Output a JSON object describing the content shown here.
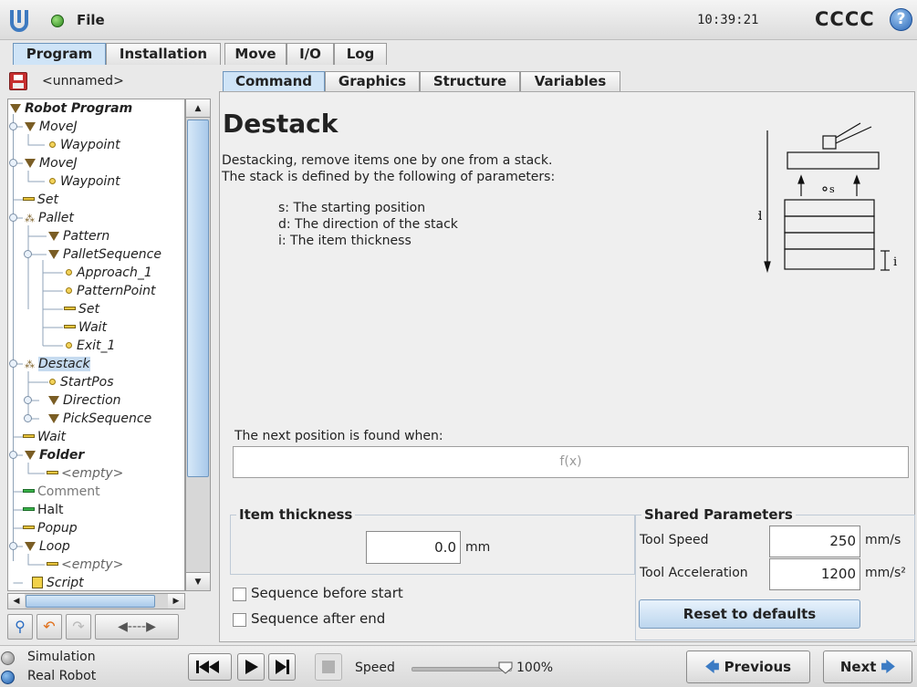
{
  "header": {
    "file_label": "File",
    "clock": "10:39:21",
    "robot_name": "CCCC",
    "help_label": "?"
  },
  "main_tabs": [
    {
      "label": "Program",
      "active": true
    },
    {
      "label": "Installation",
      "active": false
    },
    {
      "label": "Move",
      "active": false
    },
    {
      "label": "I/O",
      "active": false
    },
    {
      "label": "Log",
      "active": false
    }
  ],
  "program": {
    "name": "<unnamed>"
  },
  "tree": [
    {
      "label": "Robot Program",
      "icon": "triangle-icon",
      "style": "bold"
    },
    {
      "label": "MoveJ",
      "icon": "triangle-icon"
    },
    {
      "label": "Waypoint",
      "icon": "waypoint-icon"
    },
    {
      "label": "MoveJ",
      "icon": "triangle-icon"
    },
    {
      "label": "Waypoint",
      "icon": "waypoint-icon"
    },
    {
      "label": "Set",
      "icon": "set-icon"
    },
    {
      "label": "Pallet",
      "icon": "pallet-icon"
    },
    {
      "label": "Pattern",
      "icon": "triangle-icon"
    },
    {
      "label": "PalletSequence",
      "icon": "triangle-icon"
    },
    {
      "label": "Approach_1",
      "icon": "waypoint-icon"
    },
    {
      "label": "PatternPoint",
      "icon": "waypoint-icon"
    },
    {
      "label": "Set",
      "icon": "set-icon"
    },
    {
      "label": "Wait",
      "icon": "wait-icon"
    },
    {
      "label": "Exit_1",
      "icon": "waypoint-icon"
    },
    {
      "label": "Destack",
      "icon": "pallet-icon",
      "selected": true
    },
    {
      "label": "StartPos",
      "icon": "waypoint-icon"
    },
    {
      "label": "Direction",
      "icon": "triangle-icon"
    },
    {
      "label": "PickSequence",
      "icon": "triangle-icon"
    },
    {
      "label": "Wait",
      "icon": "wait-icon"
    },
    {
      "label": "Folder",
      "icon": "triangle-icon",
      "style": "bold"
    },
    {
      "label": "<empty>",
      "icon": "set-icon",
      "style": "grey-italic"
    },
    {
      "label": "Comment",
      "icon": "comment-icon",
      "style": "grey"
    },
    {
      "label": "Halt",
      "icon": "halt-icon",
      "style": "plain"
    },
    {
      "label": "Popup",
      "icon": "set-icon"
    },
    {
      "label": "Loop",
      "icon": "triangle-icon"
    },
    {
      "label": "<empty>",
      "icon": "set-icon",
      "style": "grey-italic"
    },
    {
      "label": "Script",
      "icon": "script-icon"
    }
  ],
  "sub_tabs": [
    {
      "label": "Command",
      "active": true
    },
    {
      "label": "Graphics",
      "active": false
    },
    {
      "label": "Structure",
      "active": false
    },
    {
      "label": "Variables",
      "active": false
    }
  ],
  "command": {
    "title": "Destack",
    "desc_line1": "Destacking, remove items one by one from a stack.",
    "desc_line2": "The stack is defined by the following of parameters:",
    "param_s": "s: The starting position",
    "param_d": "d: The direction of the stack",
    "param_i": "i: The item thickness",
    "next_label": "The next position is found when:",
    "expression_placeholder": "f(x)",
    "diagram_labels": {
      "d": "d",
      "s": "s",
      "i": "i"
    }
  },
  "item_thickness": {
    "title": "Item thickness",
    "value": "0.0",
    "unit": "mm"
  },
  "shared": {
    "title": "Shared Parameters",
    "tool_speed_label": "Tool Speed",
    "tool_speed_value": "250",
    "tool_speed_unit": "mm/s",
    "tool_accel_label": "Tool Acceleration",
    "tool_accel_value": "1200",
    "tool_accel_unit": "mm/s²",
    "reset_label": "Reset to defaults"
  },
  "checks": {
    "before_label": "Sequence before start",
    "before_checked": false,
    "after_label": "Sequence after end",
    "after_checked": false
  },
  "footer": {
    "simulation_label": "Simulation",
    "real_label": "Real Robot",
    "speed_label": "Speed",
    "speed_value": "100%",
    "speed_fraction": 1.0,
    "previous_label": "Previous",
    "next_label": "Next"
  },
  "colors": {
    "accent": "#3b7bc4",
    "selection": "#c6dbf0",
    "tab_active": "#cfe4f7",
    "title_bar": "#e0e0e0"
  }
}
